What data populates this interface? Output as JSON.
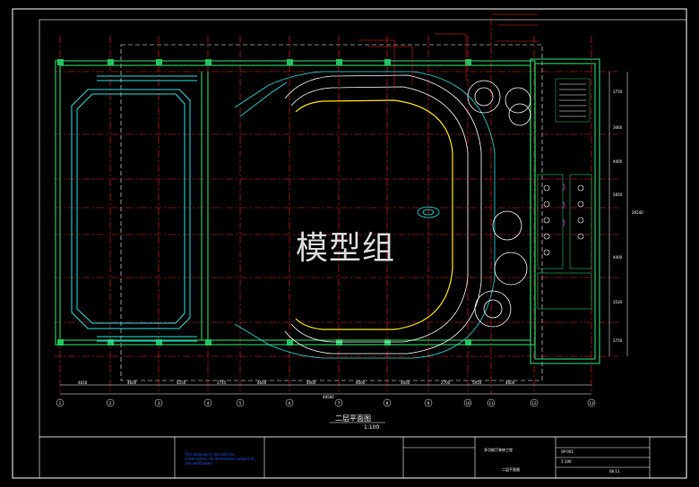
{
  "watermark": "模型组",
  "drawing": {
    "title": "二层平面图",
    "scale": "1:100",
    "overall_dim": "48560",
    "right_overall_dim": "26540",
    "bottom_dims": [
      "4650",
      "4600",
      "4250",
      "2745",
      "4600",
      "4600",
      "4600",
      "4600",
      "2700",
      "5950",
      "4600"
    ],
    "right_dims": [
      "3750",
      "3060",
      "4000",
      "5850",
      "4000",
      "3520",
      "3750"
    ],
    "axis_labels": [
      "1",
      "2",
      "3",
      "4",
      "5",
      "6",
      "7",
      "8",
      "9",
      "10",
      "11",
      "12",
      "13"
    ]
  },
  "title_block": {
    "note": "This drawing is not valid for construction. All dimensions subject to site verification.",
    "project": "多功能厅装修工程",
    "drawing_name": "二层平面图",
    "drawing_no": "SP-001",
    "scale": "1:100",
    "date": "08.11"
  },
  "colors": {
    "grid": "#ff2020",
    "wall": "#22c55e",
    "cyan": "#20e0e0",
    "yellow": "#ffe400",
    "white": "#ffffff",
    "blue": "#2060ff",
    "magenta": "#ff30ff"
  }
}
